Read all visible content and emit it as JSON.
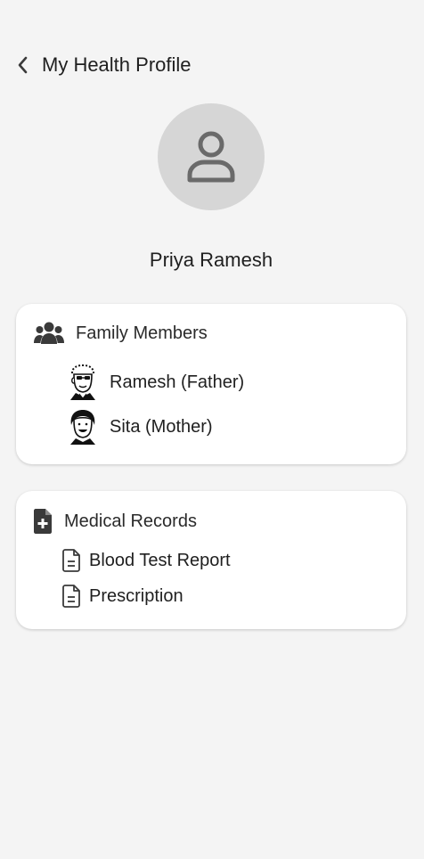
{
  "header": {
    "title": "My Health Profile"
  },
  "profile": {
    "name": "Priya Ramesh"
  },
  "family": {
    "title": "Family Members",
    "members": [
      {
        "label": "Ramesh (Father)"
      },
      {
        "label": "Sita (Mother)"
      }
    ]
  },
  "records": {
    "title": "Medical Records",
    "items": [
      {
        "label": "Blood Test Report"
      },
      {
        "label": "Prescription"
      }
    ]
  },
  "colors": {
    "background": "#f4f4f4",
    "card": "#ffffff",
    "avatar_bg": "#d6d6d6",
    "icon": "#3a3a3a"
  }
}
